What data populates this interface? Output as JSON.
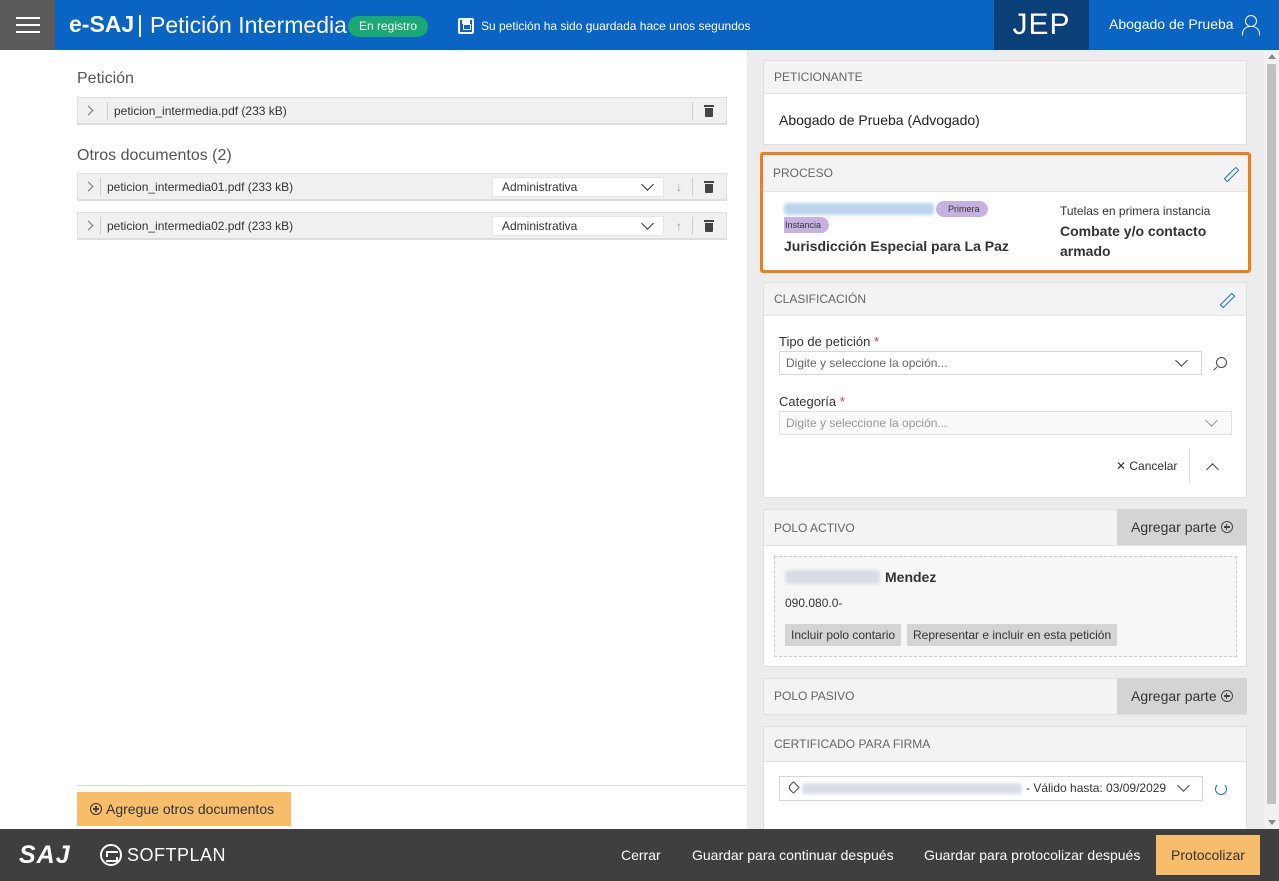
{
  "header": {
    "brand": "e-SAJ",
    "separator": "|",
    "title": "Petición Intermedia",
    "status_badge": "En registro",
    "save_message": "Su petición ha sido guardada hace unos segundos",
    "org": "JEP",
    "user": "Abogado de Prueba",
    "accent_color": "#0a64c4"
  },
  "left": {
    "peticion_title": "Petición",
    "peticion_file": "peticion_intermedia.pdf (233 kB)",
    "otros_title": "Otros documentos (2)",
    "otros_docs": [
      {
        "name": "peticion_intermedia01.pdf (233 kB)",
        "type": "Administrativa"
      },
      {
        "name": "peticion_intermedia02.pdf (233 kB)",
        "type": "Administrativa"
      }
    ],
    "add_button": "Agregue otros documentos"
  },
  "peticionante": {
    "header": "PETICIONANTE",
    "name": "Abogado de Prueba (Advogado)"
  },
  "proceso": {
    "header": "PROCESO",
    "badge_line1": "Primera",
    "badge_line2": "Instancia",
    "jurisdiccion": "Jurisdicción Especial para La Paz",
    "class_label": "Tutelas en primera instancia",
    "class_value": "Combate y/o contacto armado",
    "highlight_color": "#f07d1c"
  },
  "clasificacion": {
    "header": "CLASIFICACIÓN",
    "tipo_label": "Tipo de petición",
    "tipo_placeholder": "Digite y seleccione la opción...",
    "cat_label": "Categoría",
    "cat_placeholder": "Digite y seleccione la opción...",
    "required_mark": "*",
    "cancel": "Cancelar"
  },
  "polo_activo": {
    "header": "POLO ACTIVO",
    "add": "Agregar parte",
    "party_name": "Mendez",
    "party_doc": "090.080.0-",
    "btn_include": "Incluir polo contario",
    "btn_represent": "Representar e incluir en esta petición"
  },
  "polo_pasivo": {
    "header": "POLO PASIVO",
    "add": "Agregar parte"
  },
  "certificado": {
    "header": "CERTIFICADO PARA FIRMA",
    "valid_until": "- Válido hasta: 03/09/2029"
  },
  "footer": {
    "logo_saj": "SAJ",
    "logo_softplan": "SOFTPLAN",
    "close": "Cerrar",
    "save_continue": "Guardar para continuar después",
    "save_protocol": "Guardar para protocolizar después",
    "protocol": "Protocolizar"
  }
}
